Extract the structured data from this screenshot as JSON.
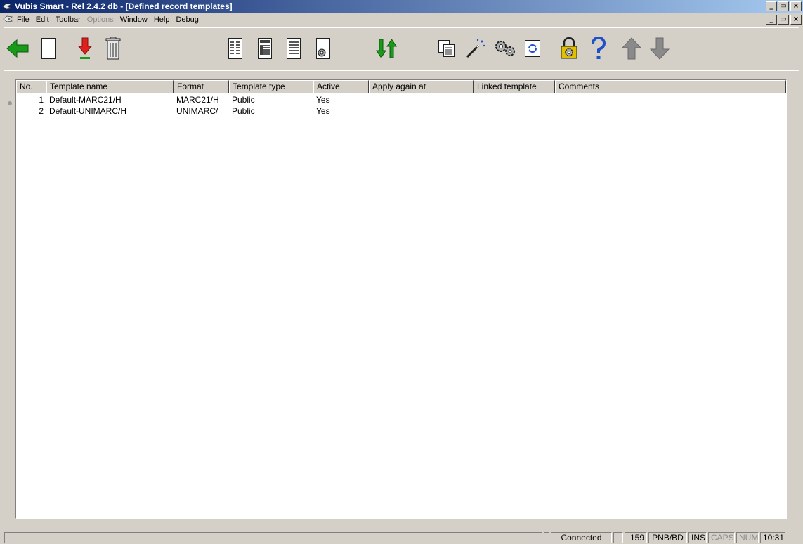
{
  "window": {
    "title": "Vubis Smart - Rel 2.4.2 db - [Defined record templates]"
  },
  "menu": {
    "items": [
      {
        "label": "File",
        "enabled": true
      },
      {
        "label": "Edit",
        "enabled": true
      },
      {
        "label": "Toolbar",
        "enabled": true
      },
      {
        "label": "Options",
        "enabled": false
      },
      {
        "label": "Window",
        "enabled": true
      },
      {
        "label": "Help",
        "enabled": true
      },
      {
        "label": "Debug",
        "enabled": true
      }
    ]
  },
  "window_buttons": {
    "minimize": "_",
    "restore": "▭",
    "close": "×"
  },
  "toolbar": {
    "icons": [
      "back-arrow-icon",
      "new-document-icon",
      "download-arrow-icon",
      "trash-icon",
      "list-view-icon",
      "detail-view-icon",
      "text-view-icon",
      "settings-document-icon",
      "sort-arrows-icon",
      "copy-icon",
      "wand-icon",
      "gears-icon",
      "refresh-icon",
      "lock-gear-icon",
      "help-icon",
      "up-arrow-icon",
      "down-arrow-icon"
    ],
    "colors": {
      "green": "#1a9a1a",
      "red": "#e0201a",
      "gray": "#8a8a8a",
      "gold": "#e0c000",
      "blue": "#2050c8"
    }
  },
  "table": {
    "columns": [
      {
        "label": "No."
      },
      {
        "label": "Template name"
      },
      {
        "label": "Format"
      },
      {
        "label": "Template type"
      },
      {
        "label": "Active"
      },
      {
        "label": "Apply again at"
      },
      {
        "label": "Linked template"
      },
      {
        "label": "Comments"
      }
    ],
    "rows": [
      {
        "no": "1",
        "name": "Default-MARC21/H",
        "format": "MARC21/H",
        "type": "Public",
        "active": "Yes",
        "apply": "",
        "linked": "",
        "comments": ""
      },
      {
        "no": "2",
        "name": "Default-UNIMARC/H",
        "format": "UNIMARC/",
        "type": "Public",
        "active": "Yes",
        "apply": "",
        "linked": "",
        "comments": ""
      }
    ]
  },
  "status": {
    "connection": "Connected",
    "count": "159",
    "location": "PNB/BD",
    "ins": "INS",
    "caps": "CAPS",
    "num": "NUM",
    "time": "10:31"
  }
}
